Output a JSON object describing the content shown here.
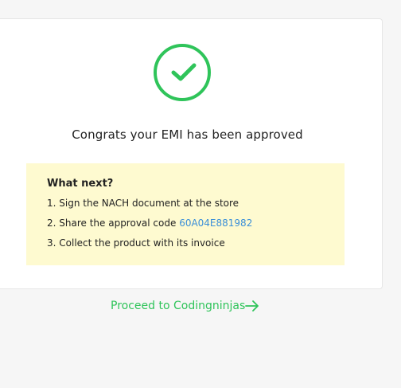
{
  "card": {
    "title": "Congrats your EMI has been approved"
  },
  "next": {
    "heading": "What next?",
    "steps": [
      {
        "prefix": "1. ",
        "text": "Sign the NACH document at the store"
      },
      {
        "prefix": "2. ",
        "text": "Share the approval code ",
        "code": "60A04E881982"
      },
      {
        "prefix": "3. ",
        "text": "Collect the product with its invoice"
      }
    ]
  },
  "proceed": {
    "label": "Proceed to Codingninjas"
  },
  "icons": {
    "success": "check-circle-icon",
    "proceed": "arrow-right-icon"
  },
  "colors": {
    "accent_green": "#2fc45a",
    "code_blue": "#3b8fd8",
    "note_bg": "#fefad0"
  }
}
